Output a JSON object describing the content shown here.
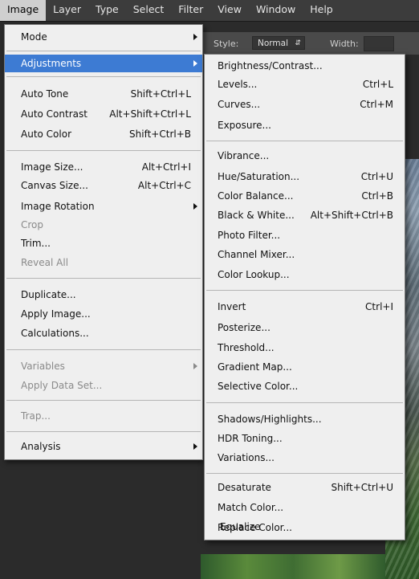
{
  "menubar": {
    "items": [
      "Image",
      "Layer",
      "Type",
      "Select",
      "Filter",
      "View",
      "Window",
      "Help"
    ],
    "active": "Image"
  },
  "optionsbar": {
    "style_label": "Style:",
    "style_value": "Normal",
    "width_label": "Width:"
  },
  "image_menu": {
    "mode": "Mode",
    "adjustments": "Adjustments",
    "auto_tone": {
      "label": "Auto Tone",
      "shortcut": "Shift+Ctrl+L"
    },
    "auto_contrast": {
      "label": "Auto Contrast",
      "shortcut": "Alt+Shift+Ctrl+L"
    },
    "auto_color": {
      "label": "Auto Color",
      "shortcut": "Shift+Ctrl+B"
    },
    "image_size": {
      "label": "Image Size...",
      "shortcut": "Alt+Ctrl+I"
    },
    "canvas_size": {
      "label": "Canvas Size...",
      "shortcut": "Alt+Ctrl+C"
    },
    "image_rotation": "Image Rotation",
    "crop": "Crop",
    "trim": "Trim...",
    "reveal_all": "Reveal All",
    "duplicate": "Duplicate...",
    "apply_image": "Apply Image...",
    "calculations": "Calculations...",
    "variables": "Variables",
    "apply_data_set": "Apply Data Set...",
    "trap": "Trap...",
    "analysis": "Analysis"
  },
  "adjustments_menu": {
    "brightness_contrast": "Brightness/Contrast...",
    "levels": {
      "label": "Levels...",
      "shortcut": "Ctrl+L"
    },
    "curves": {
      "label": "Curves...",
      "shortcut": "Ctrl+M"
    },
    "exposure": "Exposure...",
    "vibrance": "Vibrance...",
    "hue_saturation": {
      "label": "Hue/Saturation...",
      "shortcut": "Ctrl+U"
    },
    "color_balance": {
      "label": "Color Balance...",
      "shortcut": "Ctrl+B"
    },
    "black_white": {
      "label": "Black & White...",
      "shortcut": "Alt+Shift+Ctrl+B"
    },
    "photo_filter": "Photo Filter...",
    "channel_mixer": "Channel Mixer...",
    "color_lookup": "Color Lookup...",
    "invert": {
      "label": "Invert",
      "shortcut": "Ctrl+I"
    },
    "posterize": "Posterize...",
    "threshold": "Threshold...",
    "gradient_map": "Gradient Map...",
    "selective_color": "Selective Color...",
    "shadows_highlights": "Shadows/Highlights...",
    "hdr_toning": "HDR Toning...",
    "variations": "Variations...",
    "desaturate": {
      "label": "Desaturate",
      "shortcut": "Shift+Ctrl+U"
    },
    "match_color": "Match Color...",
    "replace_color": "Replace Color...",
    "equalize": "Equalize"
  },
  "colors": {
    "highlight": "#3d7bd3",
    "menu_bg": "#efefef",
    "disabled_text": "#8a8a8a"
  }
}
